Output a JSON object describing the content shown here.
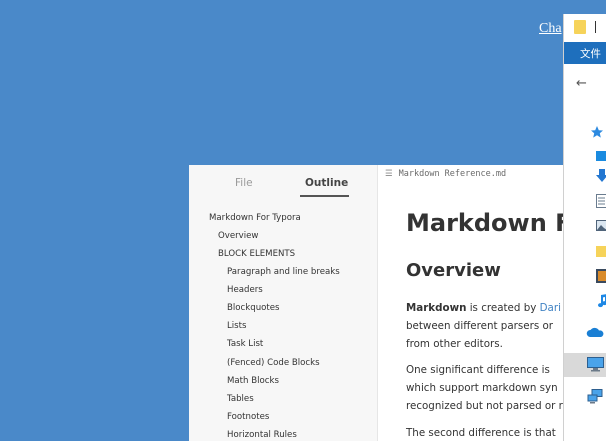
{
  "desktop": {
    "link_text": "Cha"
  },
  "typora": {
    "sidebar": {
      "tabs": [
        {
          "label": "File",
          "active": false
        },
        {
          "label": "Outline",
          "active": true
        }
      ],
      "outline": [
        {
          "label": "Markdown For Typora",
          "level": 1
        },
        {
          "label": "Overview",
          "level": 2
        },
        {
          "label": "BLOCK ELEMENTS",
          "level": 2
        },
        {
          "label": "Paragraph and line breaks",
          "level": 3
        },
        {
          "label": "Headers",
          "level": 3
        },
        {
          "label": "Blockquotes",
          "level": 3
        },
        {
          "label": "Lists",
          "level": 3
        },
        {
          "label": "Task List",
          "level": 3
        },
        {
          "label": "(Fenced) Code Blocks",
          "level": 3
        },
        {
          "label": "Math Blocks",
          "level": 3
        },
        {
          "label": "Tables",
          "level": 3
        },
        {
          "label": "Footnotes",
          "level": 3
        },
        {
          "label": "Horizontal Rules",
          "level": 3
        }
      ]
    },
    "document": {
      "filename": "Markdown Reference.md",
      "h1": "Markdown F",
      "h2": "Overview",
      "p1_bold": "Markdown",
      "p1_text": " is created by ",
      "p1_link": "Dari",
      "p1_line2": "between different parsers or",
      "p1_line3": "from other editors.",
      "p2_line1": "One significant difference is",
      "p2_line2": "which support markdown syn",
      "p2_line3": "recognized but not parsed or r",
      "p3_line1": "The second difference is that"
    }
  },
  "explorer": {
    "ribbon_label": "文件",
    "nav_icons": [
      "quick-access-star-icon",
      "desktop-folder-icon",
      "downloads-icon",
      "documents-icon",
      "pictures-icon",
      "folder-icon",
      "videos-icon",
      "music-icon",
      "onedrive-icon",
      "this-pc-icon",
      "network-icon"
    ]
  }
}
